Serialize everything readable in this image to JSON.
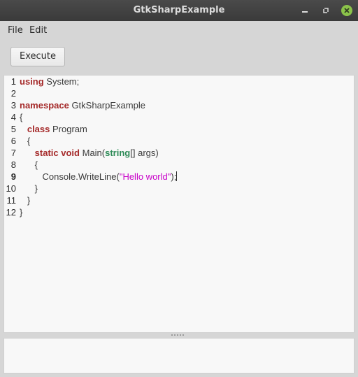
{
  "window": {
    "title": "GtkSharpExample"
  },
  "menu": {
    "file": "File",
    "edit": "Edit"
  },
  "toolbar": {
    "execute_label": "Execute"
  },
  "editor": {
    "lines": [
      {
        "num": "1",
        "tokens": [
          {
            "t": "using",
            "c": "kw"
          },
          {
            "t": " System;",
            "c": ""
          }
        ]
      },
      {
        "num": "2",
        "tokens": []
      },
      {
        "num": "3",
        "tokens": [
          {
            "t": "namespace",
            "c": "kw"
          },
          {
            "t": " GtkSharpExample",
            "c": ""
          }
        ]
      },
      {
        "num": "4",
        "tokens": [
          {
            "t": "{",
            "c": ""
          }
        ]
      },
      {
        "num": "5",
        "tokens": [
          {
            "t": "   ",
            "c": ""
          },
          {
            "t": "class",
            "c": "kw"
          },
          {
            "t": " Program",
            "c": ""
          }
        ]
      },
      {
        "num": "6",
        "tokens": [
          {
            "t": "   {",
            "c": ""
          }
        ]
      },
      {
        "num": "7",
        "tokens": [
          {
            "t": "      ",
            "c": ""
          },
          {
            "t": "static",
            "c": "kw"
          },
          {
            "t": " ",
            "c": ""
          },
          {
            "t": "void",
            "c": "kw"
          },
          {
            "t": " Main(",
            "c": ""
          },
          {
            "t": "string",
            "c": "kw-type"
          },
          {
            "t": "[] args)",
            "c": ""
          }
        ]
      },
      {
        "num": "8",
        "tokens": [
          {
            "t": "      {",
            "c": ""
          }
        ]
      },
      {
        "num": "9",
        "current": true,
        "tokens": [
          {
            "t": "         Console.WriteLine(",
            "c": ""
          },
          {
            "t": "\"Hello world\"",
            "c": "str"
          },
          {
            "t": ");",
            "c": ""
          },
          {
            "t": "",
            "c": "caret"
          }
        ]
      },
      {
        "num": "10",
        "tokens": [
          {
            "t": "      }",
            "c": ""
          }
        ]
      },
      {
        "num": "11",
        "tokens": [
          {
            "t": "   }",
            "c": ""
          }
        ]
      },
      {
        "num": "12",
        "tokens": [
          {
            "t": "}",
            "c": ""
          }
        ]
      }
    ]
  },
  "output": {
    "text": ""
  },
  "colors": {
    "keyword": "#a52a2a",
    "type_keyword": "#2e8b57",
    "string": "#c800c8",
    "close_button": "#8bc34a"
  },
  "icons": {
    "minimize": "minimize-icon",
    "maximize": "maximize-icon",
    "close": "close-icon"
  }
}
